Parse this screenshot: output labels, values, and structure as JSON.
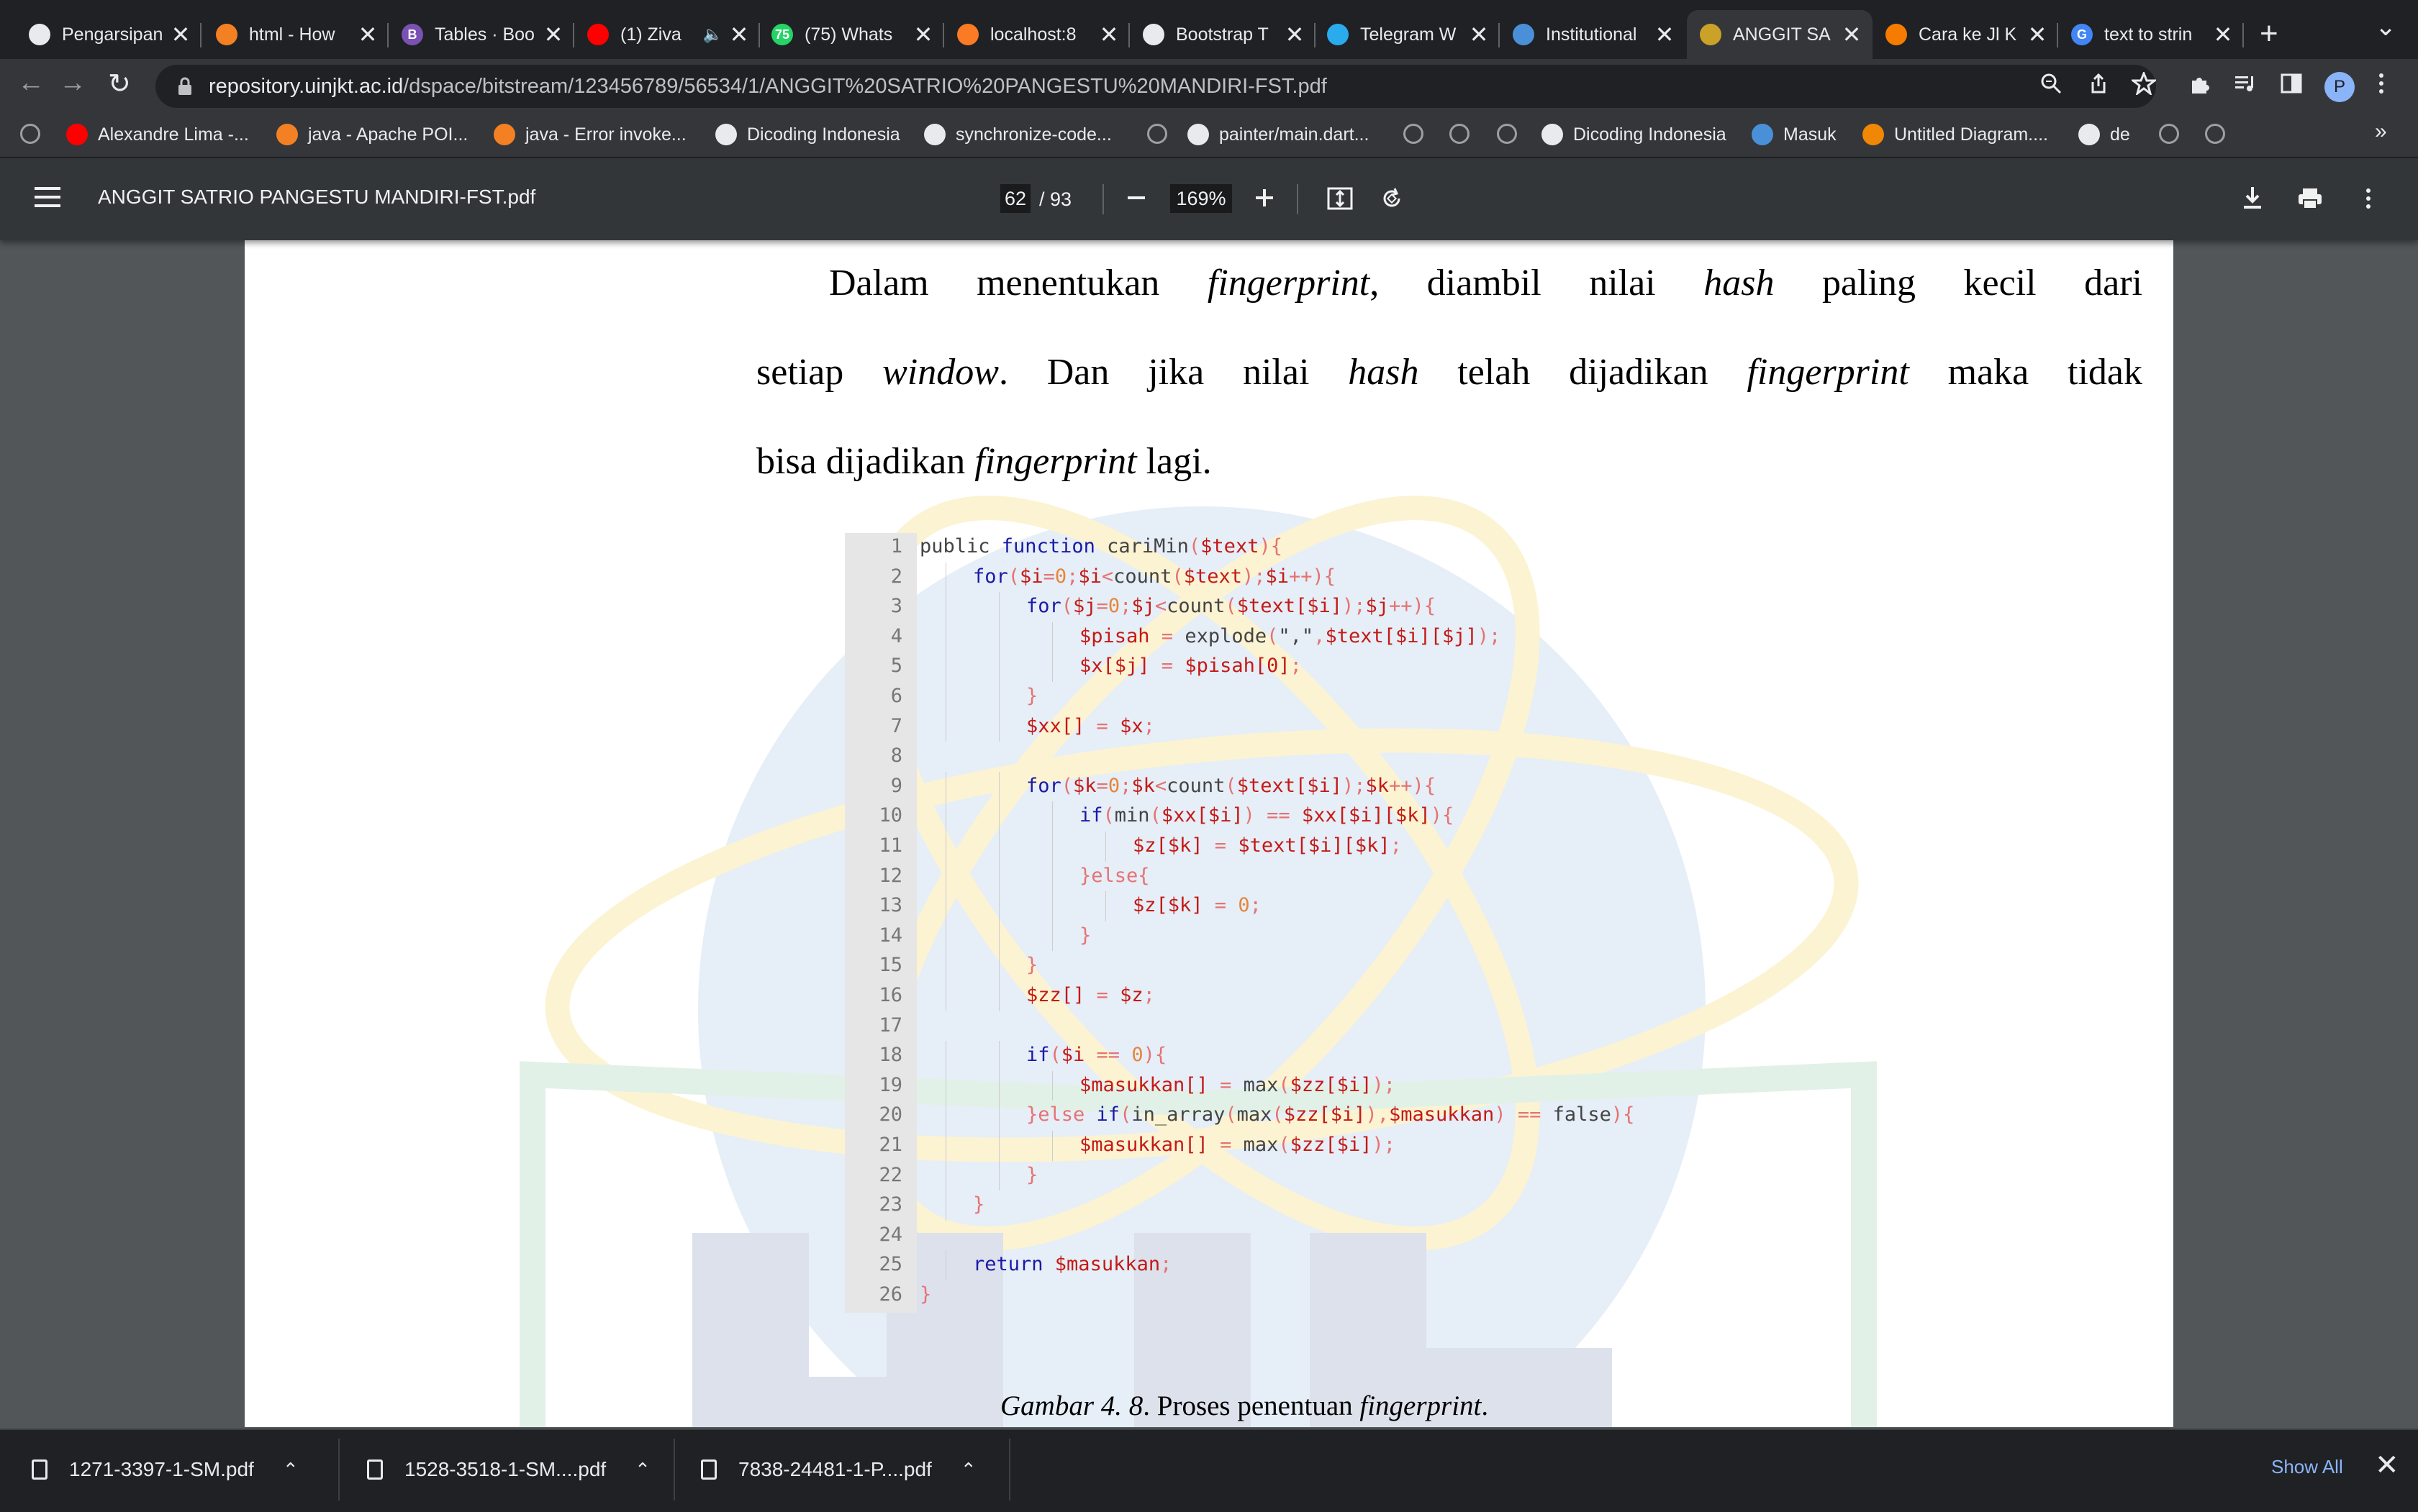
{
  "tabs": [
    {
      "label": "Pengarsipan",
      "icon": "github-icon",
      "color": "#e8eaed"
    },
    {
      "label": "html - How",
      "icon": "stackoverflow-icon",
      "color": "#f48024"
    },
    {
      "label": "Tables · Boo",
      "icon": "bootstrap-icon",
      "color": "#7952b3",
      "glyph": "B"
    },
    {
      "label": "(1) Ziva",
      "icon": "youtube-icon",
      "color": "#ff0000",
      "audio": "🔈"
    },
    {
      "label": "(75) Whats",
      "icon": "whatsapp-icon",
      "color": "#25d366",
      "glyph": "75"
    },
    {
      "label": "localhost:8",
      "icon": "xampp-icon",
      "color": "#fb7a24"
    },
    {
      "label": "Bootstrap T",
      "icon": "codesandbox-icon",
      "color": "#e8eaed"
    },
    {
      "label": "Telegram W",
      "icon": "telegram-icon",
      "color": "#2aabee"
    },
    {
      "label": "Institutional",
      "icon": "repository-icon",
      "color": "#4a90d9"
    },
    {
      "label": "ANGGIT SA",
      "icon": "pdf-icon",
      "color": "#c9a227",
      "active": true
    },
    {
      "label": "Cara ke Jl K",
      "icon": "maps-pin-icon",
      "color": "#f57c00"
    },
    {
      "label": "text to strin",
      "icon": "google-icon",
      "color": "#4285f4",
      "glyph": "G"
    }
  ],
  "omnibox": {
    "host": "repository.uinjkt.ac.id",
    "path": "/dspace/bitstream/123456789/56534/1/ANGGIT%20SATRIO%20PANGESTU%20MANDIRI-FST.pdf"
  },
  "profile_initial": "P",
  "bookmarks": [
    {
      "label": "Alexandre Lima -...",
      "icon": "youtube-icon",
      "color": "#ff0000"
    },
    {
      "label": "java - Apache POI...",
      "icon": "stackoverflow-icon",
      "color": "#f48024"
    },
    {
      "label": "java - Error invoke...",
      "icon": "stackoverflow-icon",
      "color": "#f48024"
    },
    {
      "label": "Dicoding Indonesia",
      "icon": "dicoding-icon",
      "color": "#e8eaed"
    },
    {
      "label": "synchronize-code...",
      "icon": "github-icon",
      "color": "#e8eaed"
    },
    {
      "label": "painter/main.dart...",
      "icon": "github-icon",
      "color": "#e8eaed"
    },
    {
      "label": "Dicoding Indonesia",
      "icon": "dicoding-icon",
      "color": "#e8eaed"
    },
    {
      "label": "Masuk",
      "icon": "masuk-icon",
      "color": "#4a90d9"
    },
    {
      "label": "Untitled Diagram....",
      "icon": "drawio-icon",
      "color": "#f08705"
    },
    {
      "label": "de",
      "icon": "dicoding-icon",
      "color": "#e8eaed"
    }
  ],
  "bookmarks_more": "»",
  "pdf": {
    "title": "ANGGIT SATRIO PANGESTU MANDIRI-FST.pdf",
    "page": "62",
    "total": "/ 93",
    "zoom": "169%"
  },
  "document": {
    "para_lines": [
      [
        {
          "t": "Dalam menentukan "
        },
        {
          "t": "fingerprint",
          "i": true
        },
        {
          "t": ", diambil nilai "
        },
        {
          "t": "hash",
          "i": true
        },
        {
          "t": " paling kecil dari"
        }
      ],
      [
        {
          "t": "setiap "
        },
        {
          "t": "window",
          "i": true
        },
        {
          "t": ". Dan jika nilai "
        },
        {
          "t": "hash",
          "i": true
        },
        {
          "t": " telah dijadikan "
        },
        {
          "t": "fingerprint",
          "i": true
        },
        {
          "t": " maka tidak"
        }
      ],
      [
        {
          "t": "bisa dijadikan "
        },
        {
          "t": "fingerprint",
          "i": true
        },
        {
          "t": " lagi."
        }
      ]
    ],
    "code": [
      {
        "n": "1",
        "indent": 0,
        "tokens": [
          [
            "kw-fn",
            "public function "
          ],
          [
            "fn",
            "cariMin"
          ],
          [
            "pc",
            "("
          ],
          [
            "vr",
            "$text"
          ],
          [
            "pc",
            ")"
          ],
          [
            "pc",
            "{"
          ]
        ]
      },
      {
        "n": "2",
        "indent": 1,
        "tokens": [
          [
            "kw",
            "for"
          ],
          [
            "pc",
            "("
          ],
          [
            "vr",
            "$i"
          ],
          [
            "pc",
            "="
          ],
          [
            "nm",
            "0"
          ],
          [
            "pc",
            ";"
          ],
          [
            "vr",
            "$i"
          ],
          [
            "pc",
            "<"
          ],
          [
            "fn",
            "count"
          ],
          [
            "pc",
            "("
          ],
          [
            "vr",
            "$text"
          ],
          [
            "pc",
            ")"
          ],
          [
            "pc",
            ";"
          ],
          [
            "vr",
            "$i"
          ],
          [
            "pc",
            "++){"
          ]
        ]
      },
      {
        "n": "3",
        "indent": 2,
        "tokens": [
          [
            "kw",
            "for"
          ],
          [
            "pc",
            "("
          ],
          [
            "vr",
            "$j"
          ],
          [
            "pc",
            "="
          ],
          [
            "nm",
            "0"
          ],
          [
            "pc",
            ";"
          ],
          [
            "vr",
            "$j"
          ],
          [
            "pc",
            "<"
          ],
          [
            "fn",
            "count"
          ],
          [
            "pc",
            "("
          ],
          [
            "vr",
            "$text[$i]"
          ],
          [
            "pc",
            ")"
          ],
          [
            "pc",
            ";"
          ],
          [
            "vr",
            "$j"
          ],
          [
            "pc",
            "++){"
          ]
        ]
      },
      {
        "n": "4",
        "indent": 3,
        "tokens": [
          [
            "vr",
            "$pisah"
          ],
          [
            "pc",
            " = "
          ],
          [
            "fn",
            "explode"
          ],
          [
            "pc",
            "("
          ],
          [
            "fn",
            "\",\""
          ],
          [
            "pc",
            ","
          ],
          [
            "vr",
            "$text[$i][$j]"
          ],
          [
            "pc",
            ");"
          ]
        ]
      },
      {
        "n": "5",
        "indent": 3,
        "tokens": [
          [
            "vr",
            "$x[$j]"
          ],
          [
            "pc",
            " = "
          ],
          [
            "vr",
            "$pisah[0]"
          ],
          [
            "pc",
            ";"
          ]
        ]
      },
      {
        "n": "6",
        "indent": 2,
        "tokens": [
          [
            "pc",
            "}"
          ]
        ]
      },
      {
        "n": "7",
        "indent": 2,
        "tokens": [
          [
            "vr",
            "$xx[]"
          ],
          [
            "pc",
            " = "
          ],
          [
            "vr",
            "$x"
          ],
          [
            "pc",
            ";"
          ]
        ]
      },
      {
        "n": "8",
        "indent": 0,
        "tokens": []
      },
      {
        "n": "9",
        "indent": 2,
        "tokens": [
          [
            "kw",
            "for"
          ],
          [
            "pc",
            "("
          ],
          [
            "vr",
            "$k"
          ],
          [
            "pc",
            "="
          ],
          [
            "nm",
            "0"
          ],
          [
            "pc",
            ";"
          ],
          [
            "vr",
            "$k"
          ],
          [
            "pc",
            "<"
          ],
          [
            "fn",
            "count"
          ],
          [
            "pc",
            "("
          ],
          [
            "vr",
            "$text[$i]"
          ],
          [
            "pc",
            ")"
          ],
          [
            "pc",
            ";"
          ],
          [
            "vr",
            "$k"
          ],
          [
            "pc",
            "++){"
          ]
        ]
      },
      {
        "n": "10",
        "indent": 3,
        "tokens": [
          [
            "kw",
            "if"
          ],
          [
            "pc",
            "("
          ],
          [
            "fn",
            "min"
          ],
          [
            "pc",
            "("
          ],
          [
            "vr",
            "$xx[$i]"
          ],
          [
            "pc",
            ")"
          ],
          [
            "pc",
            " == "
          ],
          [
            "vr",
            "$xx[$i][$k]"
          ],
          [
            "pc",
            "){"
          ]
        ]
      },
      {
        "n": "11",
        "indent": 4,
        "tokens": [
          [
            "vr",
            "$z[$k]"
          ],
          [
            "pc",
            " = "
          ],
          [
            "vr",
            "$text[$i][$k]"
          ],
          [
            "pc",
            ";"
          ]
        ]
      },
      {
        "n": "12",
        "indent": 3,
        "tokens": [
          [
            "pc",
            "}else{"
          ]
        ]
      },
      {
        "n": "13",
        "indent": 4,
        "tokens": [
          [
            "vr",
            "$z[$k]"
          ],
          [
            "pc",
            " = "
          ],
          [
            "nm",
            "0"
          ],
          [
            "pc",
            ";"
          ]
        ]
      },
      {
        "n": "14",
        "indent": 3,
        "tokens": [
          [
            "pc",
            "}"
          ]
        ]
      },
      {
        "n": "15",
        "indent": 2,
        "tokens": [
          [
            "pc",
            "}"
          ]
        ]
      },
      {
        "n": "16",
        "indent": 2,
        "tokens": [
          [
            "vr",
            "$zz[]"
          ],
          [
            "pc",
            " = "
          ],
          [
            "vr",
            "$z"
          ],
          [
            "pc",
            ";"
          ]
        ]
      },
      {
        "n": "17",
        "indent": 0,
        "tokens": []
      },
      {
        "n": "18",
        "indent": 2,
        "tokens": [
          [
            "kw",
            "if"
          ],
          [
            "pc",
            "("
          ],
          [
            "vr",
            "$i"
          ],
          [
            "pc",
            " == "
          ],
          [
            "nm",
            "0"
          ],
          [
            "pc",
            "){"
          ]
        ]
      },
      {
        "n": "19",
        "indent": 3,
        "tokens": [
          [
            "vr",
            "$masukkan[]"
          ],
          [
            "pc",
            " = "
          ],
          [
            "fn",
            "max"
          ],
          [
            "pc",
            "("
          ],
          [
            "vr",
            "$zz[$i]"
          ],
          [
            "pc",
            ");"
          ]
        ]
      },
      {
        "n": "20",
        "indent": 2,
        "tokens": [
          [
            "pc",
            "}else "
          ],
          [
            "kw",
            "if"
          ],
          [
            "pc",
            "("
          ],
          [
            "fn",
            "in_array"
          ],
          [
            "pc",
            "("
          ],
          [
            "fn",
            "max"
          ],
          [
            "pc",
            "("
          ],
          [
            "vr",
            "$zz[$i]"
          ],
          [
            "pc",
            "),"
          ],
          [
            "vr",
            "$masukkan"
          ],
          [
            "pc",
            ") == "
          ],
          [
            "fn",
            "false"
          ],
          [
            "pc",
            "){"
          ]
        ]
      },
      {
        "n": "21",
        "indent": 3,
        "tokens": [
          [
            "vr",
            "$masukkan[]"
          ],
          [
            "pc",
            " = "
          ],
          [
            "fn",
            "max"
          ],
          [
            "pc",
            "("
          ],
          [
            "vr",
            "$zz[$i]"
          ],
          [
            "pc",
            ");"
          ]
        ]
      },
      {
        "n": "22",
        "indent": 2,
        "tokens": [
          [
            "pc",
            "}"
          ]
        ]
      },
      {
        "n": "23",
        "indent": 1,
        "tokens": [
          [
            "pc",
            "}"
          ]
        ]
      },
      {
        "n": "24",
        "indent": 0,
        "tokens": []
      },
      {
        "n": "25",
        "indent": 1,
        "tokens": [
          [
            "kw",
            "return "
          ],
          [
            "vr",
            "$masukkan"
          ],
          [
            "pc",
            ";"
          ]
        ]
      },
      {
        "n": "26",
        "indent": 0,
        "tokens": [
          [
            "pc",
            "}"
          ]
        ]
      }
    ],
    "caption": [
      {
        "t": "Gambar 4. 8",
        "i": true
      },
      {
        "t": ". Proses penentuan "
      },
      {
        "t": "fingerprint",
        "i": true
      },
      {
        "t": "."
      }
    ]
  },
  "downloads": [
    {
      "name": "1271-3397-1-SM.pdf"
    },
    {
      "name": "1528-3518-1-SM....pdf"
    },
    {
      "name": "7838-24481-1-P....pdf"
    }
  ],
  "show_all": "Show All",
  "icons": {
    "close": "✕",
    "new_tab": "+",
    "tab_overflow": "⌄",
    "back": "←",
    "forward": "→",
    "reload": "↻",
    "caret": "⌃"
  }
}
